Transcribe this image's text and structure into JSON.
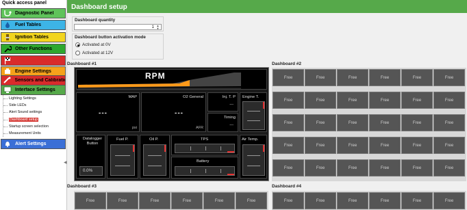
{
  "sidebar": {
    "title": "Quick access panel",
    "buttons": [
      {
        "label": "Diagnostic Panel",
        "color": "#5fc35a",
        "icon": "stethoscope-icon"
      },
      {
        "label": "Fuel Tables",
        "color": "#3db4e6",
        "icon": "fuel-icon"
      },
      {
        "label": "Ignition Tables",
        "color": "#f2d51f",
        "icon": "spark-icon"
      },
      {
        "label": "Other Functions",
        "color": "#2ea82e",
        "icon": "wrench-icon"
      },
      {
        "label": "Dragrace Features",
        "color": "#d92b2b",
        "icon": "flag-icon"
      },
      {
        "label": "Engine Settings",
        "color": "#f5a21b",
        "icon": "engine-icon"
      },
      {
        "label": "Sensors and Calibratio",
        "color": "#d92b2b",
        "icon": "sensor-icon"
      },
      {
        "label": "Interface Settings",
        "color": "#56a94a",
        "icon": "monitor-icon"
      },
      {
        "label": "Alert Settings",
        "color": "#3a6fd6",
        "icon": "bell-icon"
      }
    ],
    "subitems": [
      "Lighting Settings",
      "Side LEDs",
      "Alert Sound settings",
      "Dashboard setup",
      "Startup screen selection",
      "Measurement Units"
    ],
    "active_subitem": "Dashboard setup"
  },
  "header": {
    "title": "Dashboard setup"
  },
  "quantity": {
    "title": "Dashboard quantity",
    "value": "1"
  },
  "activation": {
    "title": "Dashboard button activation mode",
    "options": [
      "Activated at 0V",
      "Activated at 12V"
    ],
    "selected": "Activated at 0V"
  },
  "dashboards": {
    "d1": {
      "title": "Dashboard #1",
      "rpm": "RPM",
      "map": {
        "label": "MAP",
        "value": "---",
        "unit": "psi"
      },
      "o2": {
        "label": "O2 General",
        "value": "---",
        "unit": "AFR"
      },
      "inj": {
        "label": "Inj. T. P",
        "value": "---"
      },
      "timing": {
        "label": "Timing",
        "value": "---"
      },
      "engine_t": {
        "label": "Engine T."
      },
      "datalogger": {
        "label": "Datalogger Button",
        "value": "0.0%"
      },
      "fuel_p": {
        "label": "Fuel P."
      },
      "oil_p": {
        "label": "Oil P."
      },
      "tps": {
        "label": "TPS"
      },
      "battery": {
        "label": "Battery"
      },
      "air_temp": {
        "label": "Air Temp."
      }
    },
    "d2": {
      "title": "Dashboard #2"
    },
    "d3": {
      "title": "Dashboard #3"
    },
    "d4": {
      "title": "Dashboard #4"
    },
    "free_label": "Free"
  }
}
